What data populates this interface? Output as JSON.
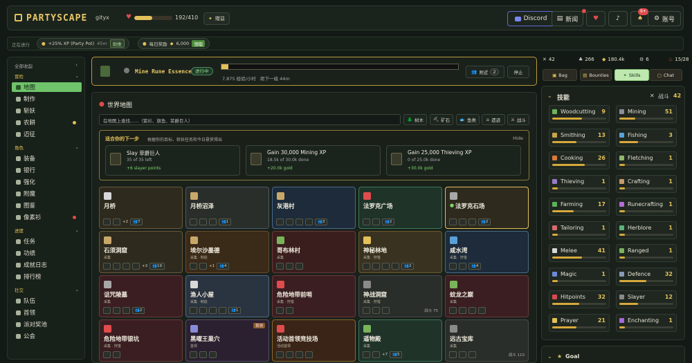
{
  "topbar": {
    "logo": "PARTYSCAPE",
    "username": "gityx",
    "hp": "192/410",
    "hp_frac": 0.47,
    "gift_btn": "赠益",
    "discord": "Discord",
    "news": "新闻",
    "notif_badge": "9+",
    "account": "账号"
  },
  "activebar": {
    "label": "正在进行",
    "boost1": "+25% XP (Party Pot)",
    "boost1_time": "45m",
    "boost1_btn": "助推",
    "boost2": "每日奖励",
    "boost2_val": "6,000",
    "boost2_btn": "领取"
  },
  "sidebar": {
    "collapse_all": "全部收起",
    "sec_adventure": "冒险",
    "items_adventure": [
      "地图",
      "制作",
      "斩妖",
      "农耕",
      "迈征"
    ],
    "sec_character": "角色",
    "items_character": [
      "装备",
      "银行",
      "强化",
      "附魔",
      "图鉴",
      "像素衫"
    ],
    "sec_progress": "进度",
    "items_progress": [
      "任务",
      "功绩",
      "成就日志",
      "排行榜"
    ],
    "sec_social": "社交",
    "items_social": [
      "队伍",
      "首领",
      "派对奖池",
      "公会"
    ]
  },
  "task": {
    "name": "Mine Rune Essence",
    "status": "进行中",
    "progress_frac": 0.03,
    "rate": "7,875 经验/小时",
    "next": "距下一级 44m",
    "nearby": "附近",
    "nearby_count": "2",
    "stop": "停止"
  },
  "map": {
    "title": "世界地图",
    "search_placeholder": "在地图上查找......（紫衫、旗鱼、菲爵巨人）",
    "filters": [
      "树木",
      "矿石",
      "鱼类",
      "遗迹",
      "战斗"
    ],
    "next_title": "适合你的下一步",
    "next_sub": "根据你的目标、斩妖任务和今日悬赏得出",
    "hide": "Hide",
    "suggestions": [
      {
        "title": "Slay 菲爵巨人",
        "sub": "35 of 35 left",
        "reward": "+6 slayer points"
      },
      {
        "title": "Gain 30,000 Mining XP",
        "sub": "18.5k of 30.0k done",
        "reward": "+20.0k gold"
      },
      {
        "title": "Gain 25,000 Thieving XP",
        "sub": "0 of 25.0k done",
        "reward": "+30.0k gold"
      }
    ],
    "locations": [
      {
        "name": "月桥",
        "sub": "",
        "extra": "+2",
        "people": "7"
      },
      {
        "name": "月桥沼泽",
        "sub": "",
        "extra": "",
        "people": "1"
      },
      {
        "name": "灰港村",
        "sub": "",
        "extra": "",
        "people": "3"
      },
      {
        "name": "法罗克广场",
        "sub": "",
        "extra": "",
        "people": "2"
      },
      {
        "name": "法罗克石场",
        "sub": "",
        "extra": "",
        "people": "2"
      },
      {
        "name": "石须洞窟",
        "sub": "采集",
        "extra": "+3",
        "people": "19"
      },
      {
        "name": "埃尔沙墨德",
        "sub": "采集 · 制造",
        "extra": "+1",
        "people": "4"
      },
      {
        "name": "哥布林村",
        "sub": "采集",
        "extra": "",
        "people": ""
      },
      {
        "name": "神秘林地",
        "sub": "采集 · 狩猎",
        "extra": "",
        "people": "2"
      },
      {
        "name": "咸水湾",
        "sub": "采集 · 狩猎",
        "extra": "",
        "people": "4"
      },
      {
        "name": "诅咒陵墓",
        "sub": "采集",
        "extra": "",
        "people": "2"
      },
      {
        "name": "渔人小屋",
        "sub": "采集 · 制造",
        "extra": "",
        "people": "1"
      },
      {
        "name": "危险地带前哨",
        "sub": "采集 · 狩猎",
        "extra": "",
        "people": ""
      },
      {
        "name": "神战洞窟",
        "sub": "采集 · 狩猎",
        "extra": "",
        "people": "",
        "tag": "",
        "combat": "战斗 75"
      },
      {
        "name": "蚊龙之巅",
        "sub": "采集",
        "extra": "",
        "people": ""
      },
      {
        "name": "危险地带银坑",
        "sub": "采集 · 狩猎",
        "extra": "",
        "people": ""
      },
      {
        "name": "黑曜王巢穴",
        "sub": "首领",
        "extra": "",
        "people": "",
        "tag": "首领"
      },
      {
        "name": "活动首领竞技场",
        "sub": "活动首领",
        "extra": "",
        "people": ""
      },
      {
        "name": "遥物殿",
        "sub": "采集",
        "extra": "+7",
        "people": "5"
      },
      {
        "name": "远古宝库",
        "sub": "采集",
        "extra": "",
        "people": "",
        "tag": "",
        "combat": "战斗 110"
      }
    ]
  },
  "right": {
    "stats": [
      "42",
      "266",
      "180.4k",
      "6",
      "15/28"
    ],
    "tabs": [
      "Bag",
      "Bounties",
      "Skills",
      "Chat"
    ],
    "skills_title": "技能",
    "combat_label": "战斗",
    "combat_level": "42",
    "skills": [
      {
        "name": "Woodcutting",
        "level": "9",
        "frac": 0.55,
        "color": "#6fb35a"
      },
      {
        "name": "Mining",
        "level": "51",
        "frac": 0.3,
        "color": "#8a8f9a"
      },
      {
        "name": "Smithing",
        "level": "13",
        "frac": 0.45,
        "color": "#c9a24a"
      },
      {
        "name": "Fishing",
        "level": "3",
        "frac": 0.35,
        "color": "#5aa0d8"
      },
      {
        "name": "Cooking",
        "level": "26",
        "frac": 0.6,
        "color": "#d87a3a"
      },
      {
        "name": "Fletching",
        "level": "1",
        "frac": 0.1,
        "color": "#8fb86a"
      },
      {
        "name": "Thieving",
        "level": "1",
        "frac": 0.1,
        "color": "#9a7ac8"
      },
      {
        "name": "Crafting",
        "level": "1",
        "frac": 0.1,
        "color": "#c89a6a"
      },
      {
        "name": "Farming",
        "level": "17",
        "frac": 0.4,
        "color": "#5ab35a"
      },
      {
        "name": "Runecrafting",
        "level": "1",
        "frac": 0.1,
        "color": "#b86ad8"
      },
      {
        "name": "Tailoring",
        "level": "1",
        "frac": 0.1,
        "color": "#d86a6a"
      },
      {
        "name": "Herblore",
        "level": "1",
        "frac": 0.1,
        "color": "#5ab37a"
      },
      {
        "name": "Melee",
        "level": "41",
        "frac": 0.55,
        "color": "#d8d8d8"
      },
      {
        "name": "Ranged",
        "level": "1",
        "frac": 0.1,
        "color": "#7ab35a"
      },
      {
        "name": "Magic",
        "level": "1",
        "frac": 0.1,
        "color": "#6a8ad8"
      },
      {
        "name": "Defence",
        "level": "32",
        "frac": 0.5,
        "color": "#8a9ab8"
      },
      {
        "name": "Hitpoints",
        "level": "32",
        "frac": 0.5,
        "color": "#d84a4a"
      },
      {
        "name": "Slayer",
        "level": "12",
        "frac": 0.35,
        "color": "#8a8a8a"
      },
      {
        "name": "Prayer",
        "level": "21",
        "frac": 0.45,
        "color": "#e3c15a"
      },
      {
        "name": "Enchanting",
        "level": "1",
        "frac": 0.1,
        "color": "#a86ad8"
      }
    ],
    "goal": "Goal"
  }
}
